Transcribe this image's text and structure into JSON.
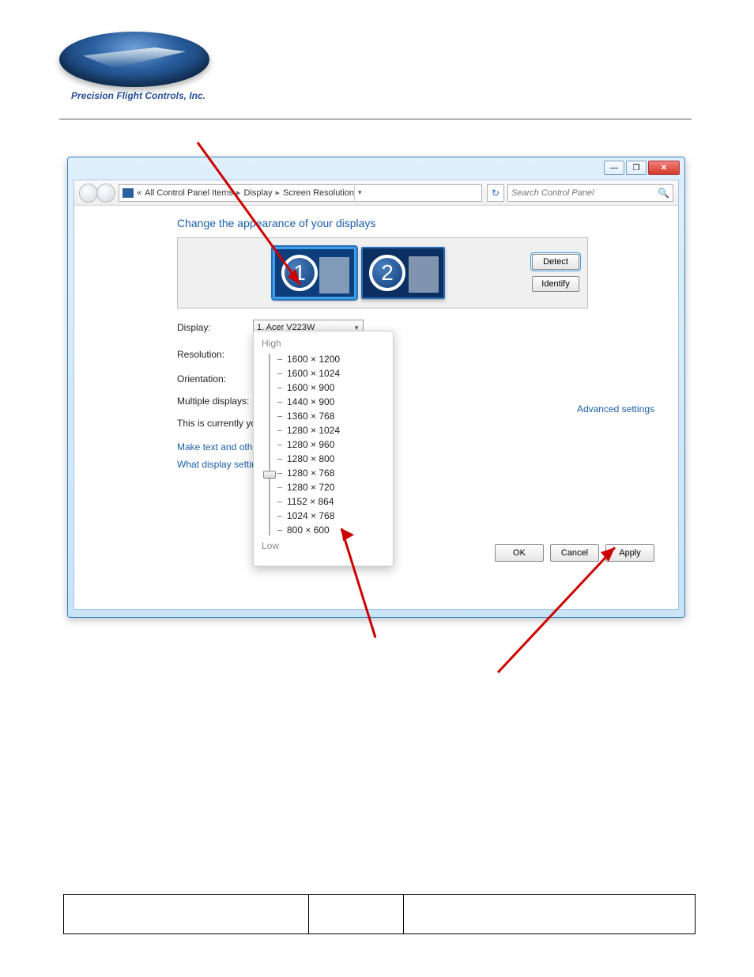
{
  "logo": {
    "company": "Precision Flight Controls, Inc."
  },
  "window": {
    "title_buttons": {
      "min": "—",
      "max": "❐",
      "close": "✕"
    },
    "breadcrumb": {
      "double_chevron": "«",
      "seg1": "All Control Panel Items",
      "seg2": "Display",
      "seg3": "Screen Resolution",
      "arrow": "▸"
    },
    "refresh": "↻",
    "search": {
      "placeholder": "Search Control Panel"
    }
  },
  "heading": "Change the appearance of your displays",
  "displays_box": {
    "monitor1_num": "1",
    "monitor2_num": "2",
    "detect": "Detect",
    "identify": "Identify"
  },
  "form": {
    "display_label": "Display:",
    "display_value": "1. Acer V223W",
    "resolution_label": "Resolution:",
    "resolution_value": "1280 × 768",
    "orientation_label": "Orientation:",
    "multiple_label": "Multiple displays:",
    "main_note": "This is currently you",
    "link1": "Make text and other",
    "link2": "What display setting",
    "advanced": "Advanced settings"
  },
  "res_popup": {
    "high": "High",
    "low": "Low",
    "options": [
      "1600 × 1200",
      "1600 × 1024",
      "1600 × 900",
      "1440 × 900",
      "1360 × 768",
      "1280 × 1024",
      "1280 × 960",
      "1280 × 800",
      "1280 × 768",
      "1280 × 720",
      "1152 × 864",
      "1024 × 768",
      "800 × 600"
    ],
    "selected_index": 8
  },
  "buttons": {
    "ok": "OK",
    "cancel": "Cancel",
    "apply": "Apply"
  }
}
